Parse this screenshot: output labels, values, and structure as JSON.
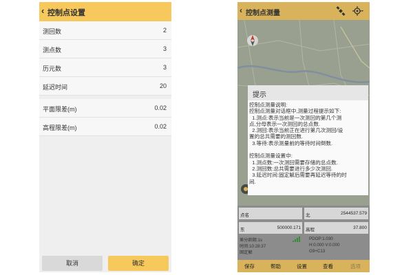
{
  "left": {
    "title": "控制点设置",
    "rows": [
      {
        "label": "测回数",
        "value": "2"
      },
      {
        "label": "测点数",
        "value": "3"
      },
      {
        "label": "历元数",
        "value": "3"
      },
      {
        "label": "延迟时间",
        "value": "20"
      }
    ],
    "rows2": [
      {
        "label": "平面限差(m)",
        "value": "0.02"
      },
      {
        "label": "高程限差(m)",
        "value": "0.02"
      }
    ],
    "cancel_label": "取消",
    "ok_label": "确定",
    "colors": {
      "accent": "#f7c95c",
      "button_gray": "#d9d9d9"
    }
  },
  "right": {
    "title": "控制点测量",
    "icons": [
      "satellite-icon",
      "gps-target-icon",
      "compass-icon"
    ],
    "dialog": {
      "title": "提示",
      "lines": [
        "控制点测量说明:",
        "控制点测量对话框中,测量过程提示如下:",
        "  1.测点:表示当前是一次测回的第几个测",
        "点,分母表示一次测回的总点数.",
        "  2.测回:表示当前正在进行第几次测回/设",
        "置的总共需要的测回数.",
        "  3.等待:表示测量前的等待时间倒数.",
        "",
        "控制点测量设置中:",
        "  1.测点数:一次测回需要存储的总点数.",
        "  2.测回数:总共需要进行多少次测回.",
        "  3.延迟时间:固定解后需要再延迟等待的时",
        "间."
      ]
    },
    "fields": {
      "point_label": "点名",
      "point_value": "",
      "north_label": "北",
      "north_value": "2544537.579",
      "east_label": "东",
      "east_value": "500000.171",
      "height_label": "高程",
      "height_value": "37.800"
    },
    "status": {
      "diff_age": "差分龄期:1s",
      "time": "时间:10:28:37",
      "fix": "固定解",
      "pdop": "PDOP:1.030",
      "hv": "H:0.000  V:0.000",
      "sats": "G9+C13"
    },
    "buttons": [
      "保存",
      "帮助",
      "设置",
      "查看",
      "选项"
    ],
    "colors": {
      "accent": "#d9b35c"
    }
  }
}
